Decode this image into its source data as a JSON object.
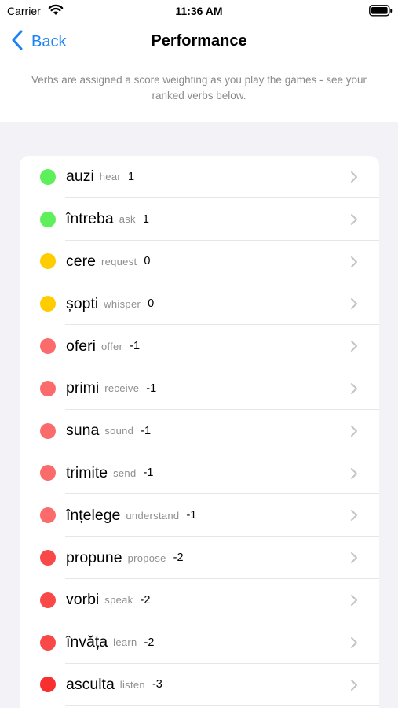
{
  "status_bar": {
    "carrier": "Carrier",
    "time": "11:36 AM"
  },
  "nav": {
    "back_label": "Back",
    "title": "Performance"
  },
  "description": "Verbs are assigned a score weighting as you play the games - see your ranked verbs below.",
  "colors": {
    "accent": "#1a82f7",
    "green": "#5ef05a",
    "yellow": "#ffcc00",
    "red_light": "#fb6b6b",
    "red_mid": "#f94848",
    "red_strong": "#f72f2f"
  },
  "icons": {
    "back": "chevron-left-icon",
    "row_disclosure": "chevron-right-icon",
    "wifi": "wifi-icon",
    "battery": "battery-icon"
  },
  "verbs": [
    {
      "verb": "auzi",
      "translation": "hear",
      "score": "1",
      "color": "#5ef05a"
    },
    {
      "verb": "întreba",
      "translation": "ask",
      "score": "1",
      "color": "#5ef05a"
    },
    {
      "verb": "cere",
      "translation": "request",
      "score": "0",
      "color": "#ffcc00"
    },
    {
      "verb": "șopti",
      "translation": "whisper",
      "score": "0",
      "color": "#ffcc00"
    },
    {
      "verb": "oferi",
      "translation": "offer",
      "score": "-1",
      "color": "#fb6b6b"
    },
    {
      "verb": "primi",
      "translation": "receive",
      "score": "-1",
      "color": "#fb6b6b"
    },
    {
      "verb": "suna",
      "translation": "sound",
      "score": "-1",
      "color": "#fb6b6b"
    },
    {
      "verb": "trimite",
      "translation": "send",
      "score": "-1",
      "color": "#fb6b6b"
    },
    {
      "verb": "înțelege",
      "translation": "understand",
      "score": "-1",
      "color": "#fb6b6b"
    },
    {
      "verb": "propune",
      "translation": "propose",
      "score": "-2",
      "color": "#f94848"
    },
    {
      "verb": "vorbi",
      "translation": "speak",
      "score": "-2",
      "color": "#f94848"
    },
    {
      "verb": "învăța",
      "translation": "learn",
      "score": "-2",
      "color": "#f94848"
    },
    {
      "verb": "asculta",
      "translation": "listen",
      "score": "-3",
      "color": "#f72f2f"
    }
  ]
}
